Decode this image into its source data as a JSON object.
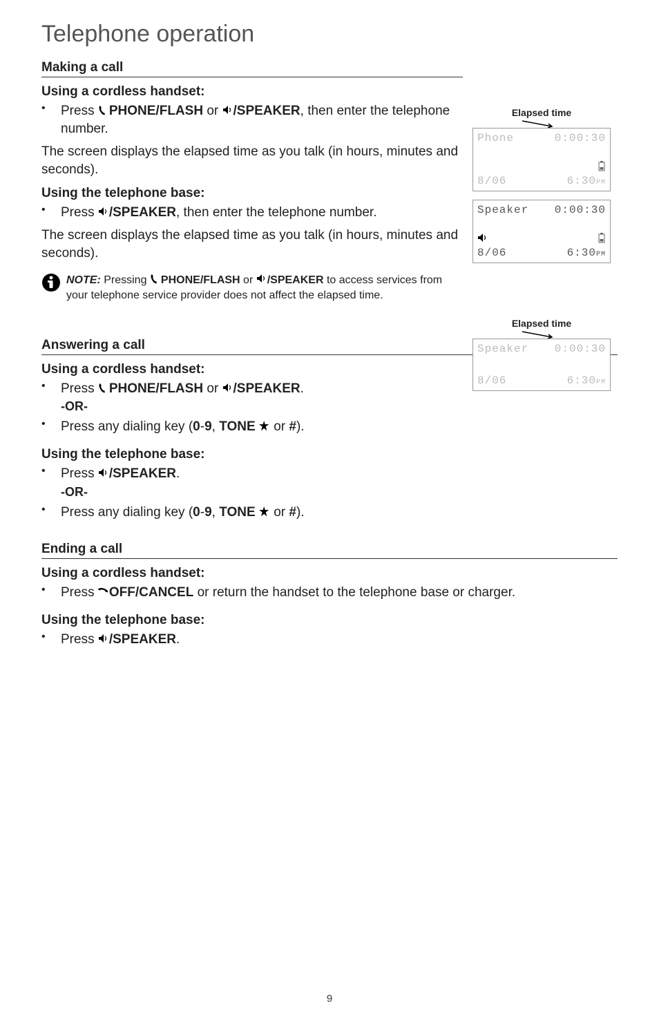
{
  "page_title": "Telephone operation",
  "sections": {
    "making": {
      "title": "Making a call",
      "cordless_title": "Using a cordless handset:",
      "cordless_bullet_prefix": "Press ",
      "phone_flash": "PHONE/",
      "flash_sc": "FLASH",
      "or_word": " or ",
      "speaker": "/SPEAKER",
      "cordless_bullet_suffix": ", then enter the telephone number.",
      "para1": "The screen displays the elapsed time as you talk (in hours, minutes and seconds).",
      "base_title": "Using the telephone base:",
      "base_bullet_prefix": "Press ",
      "base_bullet_suffix": ", then enter the telephone number.",
      "para2": "The screen displays the elapsed time as you talk (in hours, minutes and seconds)."
    },
    "note": {
      "label": "NOTE:",
      "prefix": " Pressing ",
      "mid": " or ",
      "suffix": " to access services from your telephone service provider does not affect the elapsed time."
    },
    "answering": {
      "title": "Answering a call",
      "cordless_title": "Using a cordless handset:",
      "a1_prefix": "Press ",
      "a1_suffix": ".",
      "or": "-OR-",
      "a2_prefix": "Press any dialing key (",
      "a2_mid1": "0",
      "a2_dash": "-",
      "a2_mid2": "9",
      "a2_comma": ", ",
      "a2_tone": "TONE",
      "a2_or": " or ",
      "a2_hash": "#",
      "a2_suffix": ").",
      "base_title": "Using the telephone base:",
      "b1_prefix": "Press ",
      "b1_suffix": "."
    },
    "ending": {
      "title": "Ending a call",
      "cordless_title": "Using a cordless handset:",
      "e1_prefix": "Press ",
      "off_cancel": "OFF/",
      "cancel_sc": "CANCEL",
      "e1_suffix": " or return the handset to the telephone base or charger.",
      "base_title": "Using the telephone base:",
      "e2_prefix": "Press ",
      "e2_suffix": "."
    }
  },
  "figures": {
    "elapsed_label": "Elapsed time",
    "lcd1": {
      "top_left": "Phone",
      "top_right": "0:00:30",
      "bot_left": "8/06",
      "bot_right": "6:30",
      "ampm": "PM"
    },
    "lcd2": {
      "top_left": "Speaker",
      "top_right": "0:00:30",
      "bot_left": "8/06",
      "bot_right": "6:30",
      "ampm": "PM"
    },
    "lcd3": {
      "top_left": "Speaker",
      "top_right": "0:00:30",
      "bot_left": "8/06",
      "bot_right": "6:30",
      "ampm": "PM"
    }
  },
  "page_number": "9"
}
